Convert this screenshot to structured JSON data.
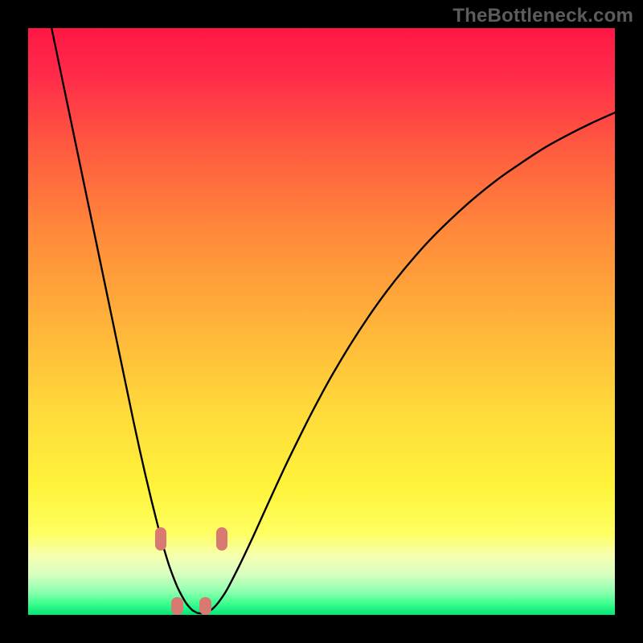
{
  "watermark": "TheBottleneck.com",
  "colors": {
    "frame": "#000000",
    "curve": "#000000",
    "marker": "#d87a72",
    "gradient_top": "#ff1744",
    "gradient_bottom": "#00e676"
  },
  "chart_data": {
    "type": "line",
    "title": "",
    "xlabel": "",
    "ylabel": "",
    "xlim": [
      0,
      100
    ],
    "ylim": [
      0,
      100
    ],
    "x": [
      4,
      5,
      6,
      7,
      8,
      9,
      10,
      11,
      12,
      13,
      14,
      15,
      16,
      17,
      18,
      19,
      20,
      21,
      22,
      23,
      23.5,
      24,
      24.5,
      25,
      25.5,
      26,
      26.5,
      27,
      27.5,
      28,
      28.5,
      29,
      30,
      31,
      32,
      33,
      34,
      36,
      38,
      40,
      42,
      44,
      46,
      48,
      50,
      52,
      55,
      58,
      61,
      64,
      68,
      72,
      76,
      80,
      84,
      88,
      92,
      96,
      100
    ],
    "y": [
      100,
      95.2,
      90.4,
      85.6,
      80.8,
      76,
      71.2,
      66.4,
      61.6,
      56.8,
      52,
      47.2,
      42.4,
      37.6,
      32.8,
      28.2,
      23.8,
      19.6,
      15.6,
      11.8,
      10.1,
      8.5,
      7.1,
      5.8,
      4.6,
      3.6,
      2.7,
      1.9,
      1.3,
      0.8,
      0.5,
      0.3,
      0.3,
      0.7,
      1.6,
      2.9,
      4.5,
      8.4,
      12.6,
      17,
      21.4,
      25.7,
      29.8,
      33.8,
      37.6,
      41.2,
      46.2,
      50.8,
      55,
      58.8,
      63.4,
      67.4,
      71,
      74.2,
      77,
      79.6,
      81.8,
      83.8,
      85.6
    ],
    "markers": [
      {
        "x": 22.6,
        "y": 13.0,
        "w": 2.0,
        "h": 4.0
      },
      {
        "x": 25.4,
        "y": 1.5,
        "w": 2.0,
        "h": 3.0
      },
      {
        "x": 30.2,
        "y": 1.5,
        "w": 2.0,
        "h": 3.0
      },
      {
        "x": 33.0,
        "y": 13.0,
        "w": 2.0,
        "h": 4.0
      }
    ]
  }
}
